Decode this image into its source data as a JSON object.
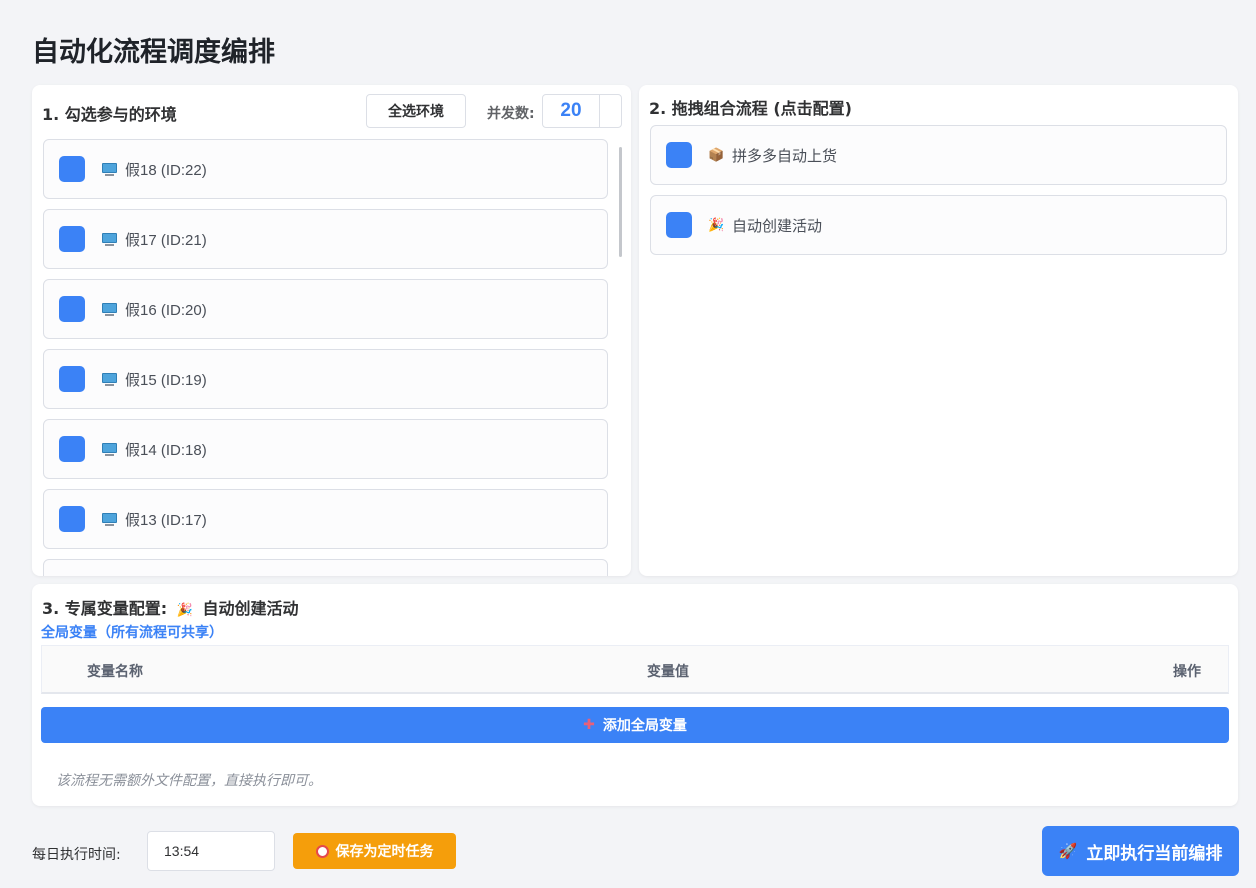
{
  "page": {
    "title": "自动化流程调度编排"
  },
  "environments": {
    "title": "1. 勾选参与的环境",
    "select_all_label": "全选环境",
    "concurrency_label": "并发数:",
    "concurrency_value": "20",
    "items": [
      {
        "label": "假18 (ID:22)",
        "checked": true,
        "icon": "desktop-computer-icon"
      },
      {
        "label": "假17 (ID:21)",
        "checked": true,
        "icon": "desktop-computer-icon"
      },
      {
        "label": "假16 (ID:20)",
        "checked": true,
        "icon": "desktop-computer-icon"
      },
      {
        "label": "假15 (ID:19)",
        "checked": true,
        "icon": "desktop-computer-icon"
      },
      {
        "label": "假14 (ID:18)",
        "checked": true,
        "icon": "desktop-computer-icon"
      },
      {
        "label": "假13 (ID:17)",
        "checked": true,
        "icon": "desktop-computer-icon"
      }
    ]
  },
  "flow": {
    "title": "2. 拖拽组合流程 (点击配置)",
    "items": [
      {
        "label": "拼多多自动上货",
        "icon": "package-icon",
        "glyph": "📦",
        "checked": true
      },
      {
        "label": "自动创建活动",
        "icon": "party-popper-icon",
        "glyph": "🎉",
        "checked": true
      }
    ]
  },
  "variables": {
    "title": "3. 专属变量配置:",
    "flow_name": "自动创建活动",
    "flow_glyph": "🎉",
    "subtitle": "全局变量（所有流程可共享）",
    "columns": {
      "name": "变量名称",
      "value": "变量值",
      "action": "操作"
    },
    "add_button_label": "添加全局变量",
    "add_button_glyph": "✚",
    "note": "该流程无需额外文件配置，直接执行即可。"
  },
  "schedule": {
    "label": "每日执行时间:",
    "time_value": "13:54",
    "save_label": "保存为定时任务"
  },
  "execute": {
    "label": "立即执行当前编排",
    "glyph": "🚀"
  },
  "colors": {
    "accent": "#3b82f6",
    "warning": "#f59e0b",
    "background": "#f3f4f7"
  }
}
